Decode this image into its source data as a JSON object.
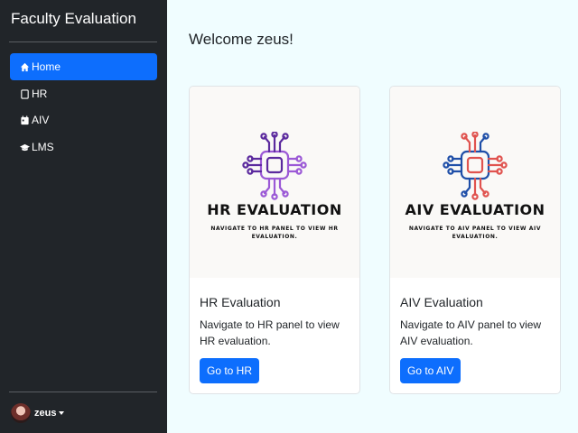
{
  "sidebar": {
    "brand": "Faculty Evaluation",
    "items": [
      {
        "label": "Home",
        "icon": "house-icon",
        "active": true
      },
      {
        "label": "HR",
        "icon": "file-icon"
      },
      {
        "label": "AIV",
        "icon": "calendar-icon"
      },
      {
        "label": "LMS",
        "icon": "mortarboard-icon"
      }
    ],
    "user": {
      "name": "zeus"
    }
  },
  "main": {
    "welcome": "Welcome zeus!",
    "cards": [
      {
        "image_title": "HR EVALUATION",
        "image_subtitle": "NAVIGATE TO HR PANEL TO VIEW HR EVALUATION.",
        "title": "HR Evaluation",
        "text": "Navigate to HR panel to view HR evaluation.",
        "button": "Go to HR",
        "colors": {
          "primary": "#9b59d6",
          "secondary": "#5b2a9e"
        }
      },
      {
        "image_title": "AIV EVALUATION",
        "image_subtitle": "NAVIGATE TO AIV PANEL TO VIEW AIV EVALUATION.",
        "title": "AIV Evaluation",
        "text": "Navigate to AIV panel to view AIV evaluation.",
        "button": "Go to AIV",
        "colors": {
          "primary": "#1f4fa8",
          "secondary": "#e0534f"
        }
      }
    ]
  },
  "colors": {
    "sidebar_bg": "#212529",
    "accent": "#0d6efd",
    "page_bg": "#f0fdff"
  }
}
